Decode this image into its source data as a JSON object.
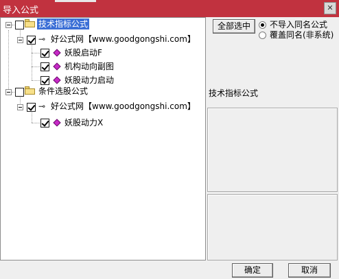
{
  "window": {
    "title": "导入公式",
    "close_glyph": "✕"
  },
  "tree": {
    "groups": [
      {
        "label": "技术指标公式",
        "checked": false,
        "selected": true,
        "source": {
          "label": "好公式网【www.goodgongshi.com】",
          "checked": true
        },
        "items": [
          {
            "label": "妖股启动F",
            "checked": true
          },
          {
            "label": "机构动向副图",
            "checked": true
          },
          {
            "label": "妖股动力启动",
            "checked": true
          }
        ]
      },
      {
        "label": "条件选股公式",
        "checked": false,
        "selected": false,
        "source": {
          "label": "好公式网【www.goodgongshi.com】",
          "checked": true
        },
        "items": [
          {
            "label": "妖股动力X",
            "checked": true
          }
        ]
      }
    ]
  },
  "right": {
    "select_all_label": "全部选中",
    "options": [
      {
        "label": "不导入同名公式",
        "selected": true
      },
      {
        "label": "覆盖同名(非系统)",
        "selected": false
      }
    ],
    "formula_type_label": "技术指标公式"
  },
  "footer": {
    "ok_label": "确定",
    "cancel_label": "取消"
  },
  "icons": {
    "folder": "folder-icon",
    "source": "key-icon",
    "formula": "diamond-icon"
  }
}
